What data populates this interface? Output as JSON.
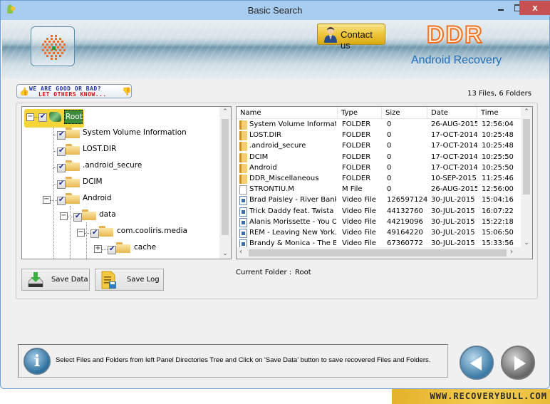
{
  "window": {
    "title": "Basic Search",
    "close_label": "x"
  },
  "header": {
    "contact_label": "Contact us",
    "brand": "DDR",
    "subtitle": "Android Recovery"
  },
  "feedback": {
    "line1": "WE ARE GOOD OR BAD?",
    "line2": "LET OTHERS KNOW..."
  },
  "summary": {
    "file_count": "13 Files, 6 Folders"
  },
  "tree": {
    "root": "Root",
    "items": [
      {
        "label": "System Volume Information",
        "checked": true
      },
      {
        "label": "LOST.DIR",
        "checked": true
      },
      {
        "label": ".android_secure",
        "checked": true
      },
      {
        "label": "DCIM",
        "checked": true
      },
      {
        "label": "Android",
        "checked": true,
        "expanded": true
      },
      {
        "label": "data",
        "checked": true,
        "expanded": true
      },
      {
        "label": "com.cooliris.media",
        "checked": true,
        "expanded": true
      },
      {
        "label": "cache",
        "checked": true,
        "expanded": false
      }
    ]
  },
  "file_list": {
    "columns": [
      "Name",
      "Type",
      "Size",
      "Date",
      "Time"
    ],
    "rows": [
      {
        "icon": "folder",
        "name": "System Volume Information",
        "type": "FOLDER",
        "size": "0",
        "date": "26-AUG-2015",
        "time": "12:56:04"
      },
      {
        "icon": "folder",
        "name": "LOST.DIR",
        "type": "FOLDER",
        "size": "0",
        "date": "17-OCT-2014",
        "time": "10:25:48"
      },
      {
        "icon": "folder",
        "name": ".android_secure",
        "type": "FOLDER",
        "size": "0",
        "date": "17-OCT-2014",
        "time": "10:25:48"
      },
      {
        "icon": "folder",
        "name": "DCIM",
        "type": "FOLDER",
        "size": "0",
        "date": "17-OCT-2014",
        "time": "10:25:50"
      },
      {
        "icon": "folder",
        "name": "Android",
        "type": "FOLDER",
        "size": "0",
        "date": "17-OCT-2014",
        "time": "10:25:50"
      },
      {
        "icon": "folder",
        "name": "DDR_Miscellaneous",
        "type": "FOLDER",
        "size": "0",
        "date": "10-SEP-2015",
        "time": "11:25:46"
      },
      {
        "icon": "file",
        "name": "STRONTIU.M",
        "type": "M File",
        "size": "0",
        "date": "26-AUG-2015",
        "time": "12:56:00"
      },
      {
        "icon": "video",
        "name": "Brad Paisley - River Bank....",
        "type": "Video File",
        "size": "126597124",
        "date": "30-JUL-2015",
        "time": "15:04:16"
      },
      {
        "icon": "video",
        "name": "Trick Daddy feat. Twista ...",
        "type": "Video File",
        "size": "44132760",
        "date": "30-JUL-2015",
        "time": "16:07:22"
      },
      {
        "icon": "video",
        "name": "Alanis Morissette - You Ou...",
        "type": "Video File",
        "size": "44219096",
        "date": "30-JUL-2015",
        "time": "15:22:18"
      },
      {
        "icon": "video",
        "name": "REM - Leaving New York....",
        "type": "Video File",
        "size": "49164220",
        "date": "30-JUL-2015",
        "time": "15:06:50"
      },
      {
        "icon": "video",
        "name": "Brandy & Monica - The Bo...",
        "type": "Video File",
        "size": "67360772",
        "date": "30-JUL-2015",
        "time": "15:33:56"
      }
    ]
  },
  "actions": {
    "save_data": "Save Data",
    "save_log": "Save Log"
  },
  "current_folder": {
    "label": "Current Folder :",
    "value": "Root"
  },
  "info": {
    "message": "Select Files and Folders from left Panel Directories Tree and Click on 'Save Data' button to save recovered Files and Folders."
  },
  "watermark": "WWW.RECOVERYBULL.COM"
}
